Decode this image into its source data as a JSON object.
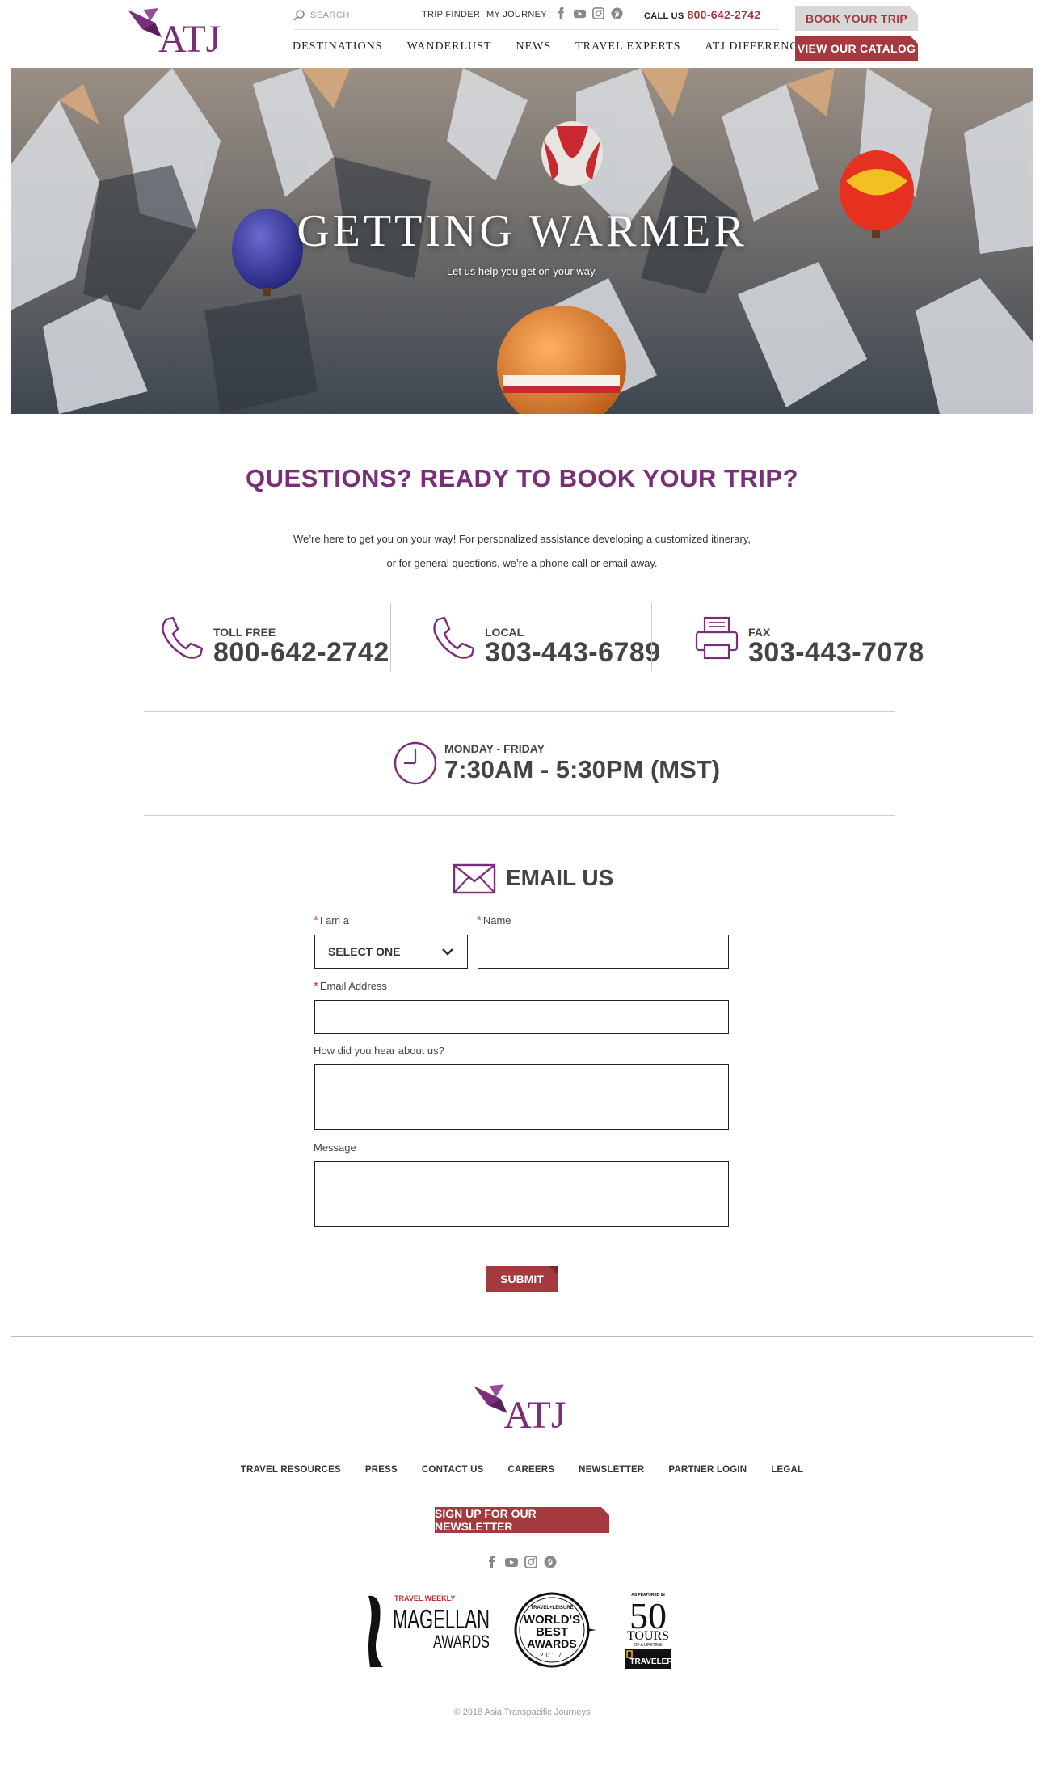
{
  "header": {
    "brand": "ATJ",
    "search_placeholder": "SEARCH",
    "util_links": [
      "TRIP FINDER",
      "MY JOURNEY"
    ],
    "call_label": "CALL US",
    "call_number": "800-642-2742",
    "nav": [
      "DESTINATIONS",
      "WANDERLUST",
      "NEWS",
      "TRAVEL EXPERTS",
      "ATJ DIFFERENCE"
    ],
    "book_button": "BOOK YOUR TRIP",
    "catalog_button": "VIEW OUR CATALOG"
  },
  "hero": {
    "title": "GETTING WARMER",
    "subtitle": "Let us help you get on your way."
  },
  "contact": {
    "title": "QUESTIONS? READY TO BOOK YOUR TRIP?",
    "text_line1": "We’re here to get you on your way! For personalized assistance developing a customized itinerary,",
    "text_line2": "or for general questions, we’re a phone call or email away.",
    "phones": [
      {
        "label": "TOLL FREE",
        "number": "800-642-2742",
        "icon": "phone-icon"
      },
      {
        "label": "LOCAL",
        "number": "303-443-6789",
        "icon": "phone-icon"
      },
      {
        "label": "FAX",
        "number": "303-443-7078",
        "icon": "fax-icon"
      }
    ],
    "hours_label": "MONDAY - FRIDAY",
    "hours_value": "7:30AM - 5:30PM (MST)"
  },
  "form": {
    "heading": "EMAIL US",
    "iam_label": "I am a",
    "iam_value": "SELECT ONE",
    "name_label": "Name",
    "email_label": "Email Address",
    "hear_label": "How did you hear about us?",
    "message_label": "Message",
    "submit": "SUBMIT"
  },
  "footer": {
    "brand": "ATJ",
    "links": [
      "TRAVEL RESOURCES",
      "PRESS",
      "CONTACT US",
      "CAREERS",
      "NEWSLETTER",
      "PARTNER LOGIN",
      "LEGAL"
    ],
    "newsletter_button": "SIGN UP FOR OUR NEWSLETTER",
    "awards": {
      "magellan_top": "TRAVEL WEEKLY",
      "magellan_main": "MAGELLAN",
      "magellan_sub": "AWARDS",
      "wba_top": "TRAVEL+LEISURE",
      "wba_line1": "WORLD'S",
      "wba_line2": "BEST",
      "wba_line3": "AWARDS",
      "wba_year": "2017",
      "ng_top": "AS FEATURED IN",
      "ng_num": "50",
      "ng_mid": "TOURS",
      "ng_small": "OF A LIFETIME",
      "ng_brand": "TRAVELER"
    },
    "copyright": "© 2018 Asia Transpacific Journeys"
  },
  "colors": {
    "brand_purple": "#7a2e7a",
    "accent_red": "#a53a3e",
    "text": "#333333"
  }
}
